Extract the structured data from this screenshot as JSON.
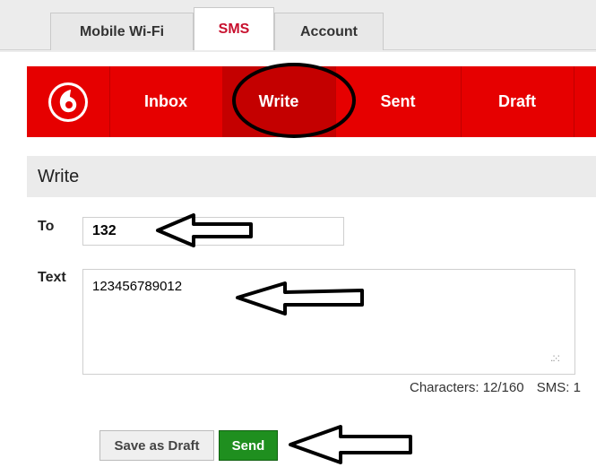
{
  "tabs": [
    {
      "label": "Mobile Wi-Fi",
      "active": false
    },
    {
      "label": "SMS",
      "active": true
    },
    {
      "label": "Account",
      "active": false
    }
  ],
  "nav": {
    "logo_icon": "vodafone-logo",
    "items": [
      {
        "label": "Inbox",
        "active": false
      },
      {
        "label": "Write",
        "active": true
      },
      {
        "label": "Sent",
        "active": false
      },
      {
        "label": "Draft",
        "active": false
      }
    ]
  },
  "write": {
    "title": "Write",
    "to_label": "To",
    "to_value": "132",
    "text_label": "Text",
    "text_value": "123456789012",
    "characters": "Characters: 12/160",
    "sms_count": "SMS: 1"
  },
  "buttons": {
    "save_draft": "Save as Draft",
    "send": "Send"
  },
  "colors": {
    "brand_red": "#e60000",
    "send_green": "#1f8f1f",
    "active_tab_text": "#c8102e"
  }
}
